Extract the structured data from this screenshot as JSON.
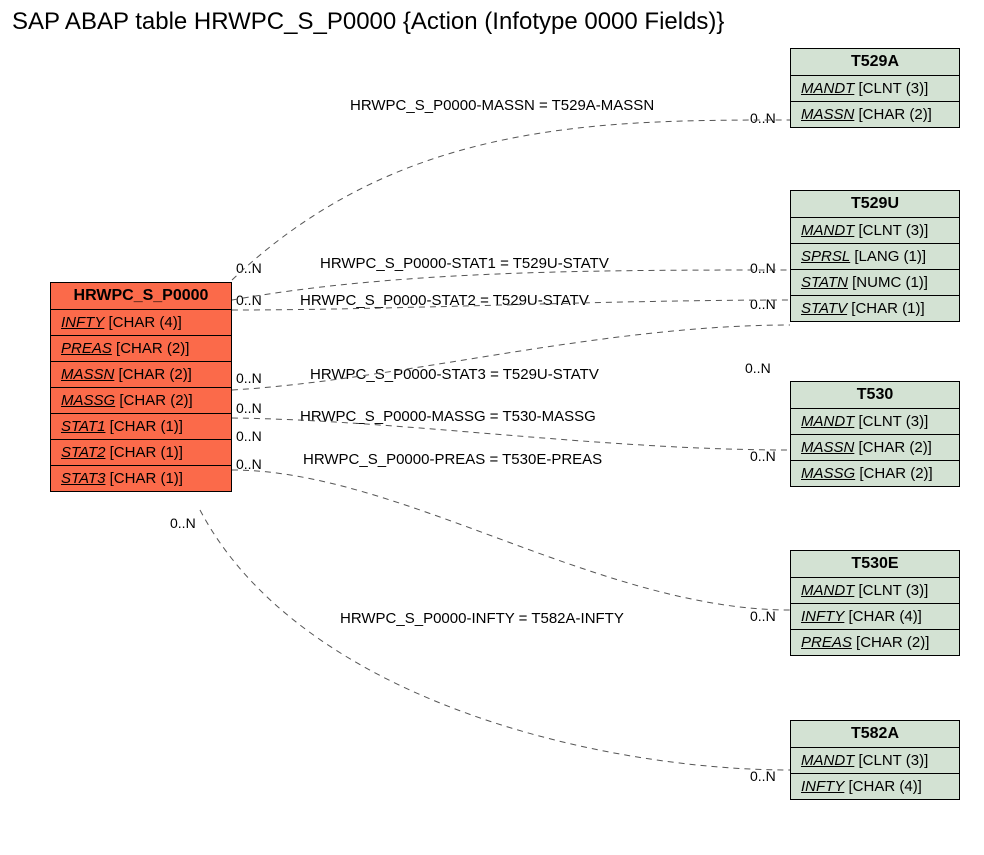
{
  "title": "SAP ABAP table HRWPC_S_P0000 {Action (Infotype 0000 Fields)}",
  "cardinality": "0..N",
  "mainEntity": {
    "name": "HRWPC_S_P0000",
    "fields": [
      {
        "name": "INFTY",
        "type": "[CHAR (4)]"
      },
      {
        "name": "PREAS",
        "type": "[CHAR (2)]"
      },
      {
        "name": "MASSN",
        "type": "[CHAR (2)]"
      },
      {
        "name": "MASSG",
        "type": "[CHAR (2)]"
      },
      {
        "name": "STAT1",
        "type": "[CHAR (1)]"
      },
      {
        "name": "STAT2",
        "type": "[CHAR (1)]"
      },
      {
        "name": "STAT3",
        "type": "[CHAR (1)]"
      }
    ]
  },
  "targets": [
    {
      "name": "T529A",
      "fields": [
        {
          "name": "MANDT",
          "type": "[CLNT (3)]"
        },
        {
          "name": "MASSN",
          "type": "[CHAR (2)]"
        }
      ]
    },
    {
      "name": "T529U",
      "fields": [
        {
          "name": "MANDT",
          "type": "[CLNT (3)]"
        },
        {
          "name": "SPRSL",
          "type": "[LANG (1)]"
        },
        {
          "name": "STATN",
          "type": "[NUMC (1)]"
        },
        {
          "name": "STATV",
          "type": "[CHAR (1)]"
        }
      ]
    },
    {
      "name": "T530",
      "fields": [
        {
          "name": "MANDT",
          "type": "[CLNT (3)]"
        },
        {
          "name": "MASSN",
          "type": "[CHAR (2)]"
        },
        {
          "name": "MASSG",
          "type": "[CHAR (2)]"
        }
      ]
    },
    {
      "name": "T530E",
      "fields": [
        {
          "name": "MANDT",
          "type": "[CLNT (3)]"
        },
        {
          "name": "INFTY",
          "type": "[CHAR (4)]"
        },
        {
          "name": "PREAS",
          "type": "[CHAR (2)]"
        }
      ]
    },
    {
      "name": "T582A",
      "fields": [
        {
          "name": "MANDT",
          "type": "[CLNT (3)]"
        },
        {
          "name": "INFTY",
          "type": "[CHAR (4)]"
        }
      ]
    }
  ],
  "relations": [
    {
      "label": "HRWPC_S_P0000-MASSN = T529A-MASSN"
    },
    {
      "label": "HRWPC_S_P0000-STAT1 = T529U-STATV"
    },
    {
      "label": "HRWPC_S_P0000-STAT2 = T529U-STATV"
    },
    {
      "label": "HRWPC_S_P0000-STAT3 = T529U-STATV"
    },
    {
      "label": "HRWPC_S_P0000-MASSG = T530-MASSG"
    },
    {
      "label": "HRWPC_S_P0000-PREAS = T530E-PREAS"
    },
    {
      "label": "HRWPC_S_P0000-INFTY = T582A-INFTY"
    }
  ]
}
